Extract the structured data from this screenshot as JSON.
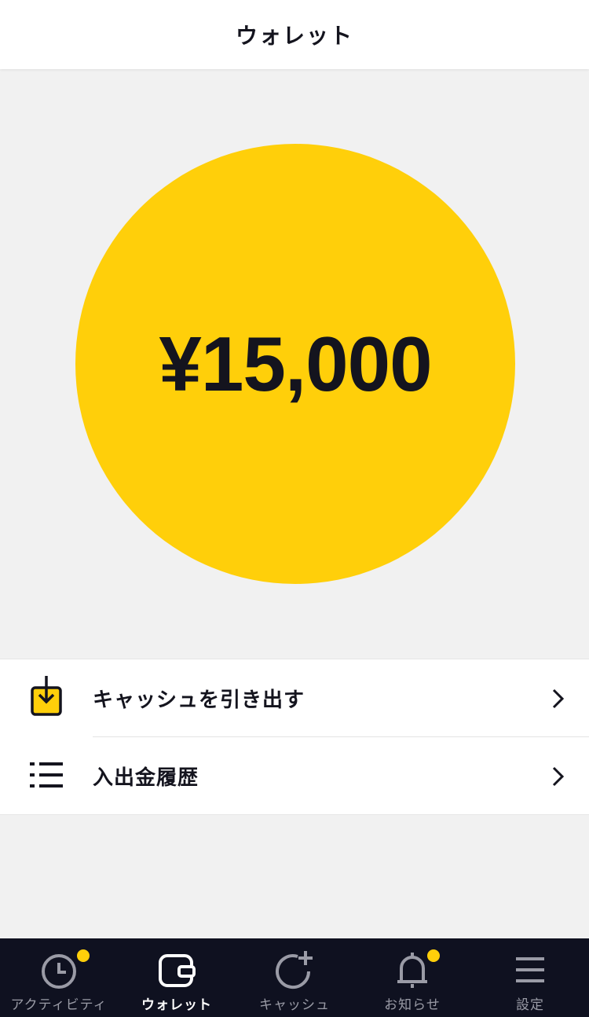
{
  "header": {
    "title": "ウォレット"
  },
  "balance": {
    "amount": "¥15,000"
  },
  "menu": {
    "items": [
      {
        "label": "キャッシュを引き出す",
        "icon": "withdraw-icon"
      },
      {
        "label": "入出金履歴",
        "icon": "list-icon"
      }
    ]
  },
  "tabbar": {
    "tabs": [
      {
        "label": "アクティビティ",
        "icon": "clock-icon",
        "badge": true
      },
      {
        "label": "ウォレット",
        "icon": "wallet-icon",
        "active": true
      },
      {
        "label": "キャッシュ",
        "icon": "refresh-plus-icon"
      },
      {
        "label": "お知らせ",
        "icon": "bell-icon",
        "badge": true
      },
      {
        "label": "設定",
        "icon": "menu-icon"
      }
    ]
  },
  "colors": {
    "accent": "#ffcf0a",
    "dark": "#14141e",
    "tabbar": "#0f1120",
    "tab_inactive": "#9a9ba6"
  }
}
